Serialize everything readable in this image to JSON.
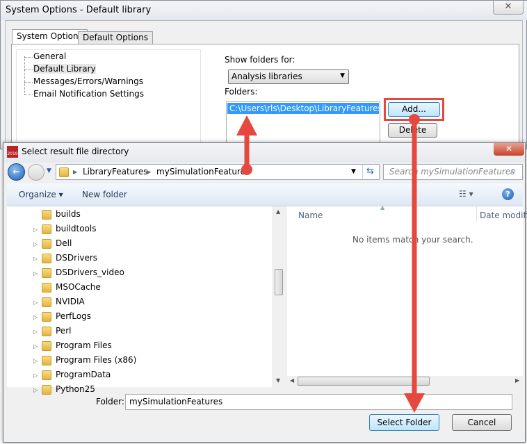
{
  "back_window": {
    "title": "System Options - Default library",
    "close": "✕",
    "tabs": [
      "System Options",
      "Default Options"
    ],
    "tree": [
      "General",
      "Default Library",
      "Messages/Errors/Warnings",
      "Email Notification Settings"
    ],
    "show_folders_label": "Show folders for:",
    "show_folders_value": "Analysis libraries",
    "folders_label": "Folders:",
    "folder_path": "C:\\Users\\rls\\Desktop\\LibraryFeatures\\mySi",
    "add_button": "Add...",
    "delete_button": "Delete"
  },
  "dialog": {
    "title": "Select result file directory",
    "icon_text": "2019",
    "close": "✕",
    "breadcrumb": [
      "LibraryFeatures",
      "mySimulationFeatures"
    ],
    "search_placeholder": "Search mySimulationFeatures",
    "organize": "Organize ▾",
    "new_folder": "New folder",
    "folders": [
      {
        "name": "builds",
        "expand": false
      },
      {
        "name": "buildtools",
        "expand": true
      },
      {
        "name": "Dell",
        "expand": true
      },
      {
        "name": "DSDrivers",
        "expand": true
      },
      {
        "name": "DSDrivers_video",
        "expand": true
      },
      {
        "name": "MSOCache",
        "expand": false
      },
      {
        "name": "NVIDIA",
        "expand": true
      },
      {
        "name": "PerfLogs",
        "expand": true
      },
      {
        "name": "Perl",
        "expand": true
      },
      {
        "name": "Program Files",
        "expand": true
      },
      {
        "name": "Program Files (x86)",
        "expand": true
      },
      {
        "name": "ProgramData",
        "expand": true
      },
      {
        "name": "Python25",
        "expand": true
      }
    ],
    "columns": [
      "Name",
      "Date modifi"
    ],
    "empty_message": "No items match your search.",
    "folder_label": "Folder:",
    "folder_value": "mySimulationFeatures",
    "select_button": "Select Folder",
    "cancel_button": "Cancel"
  },
  "colors": {
    "annotation": "#e5483e",
    "selection": "#3399ff"
  }
}
